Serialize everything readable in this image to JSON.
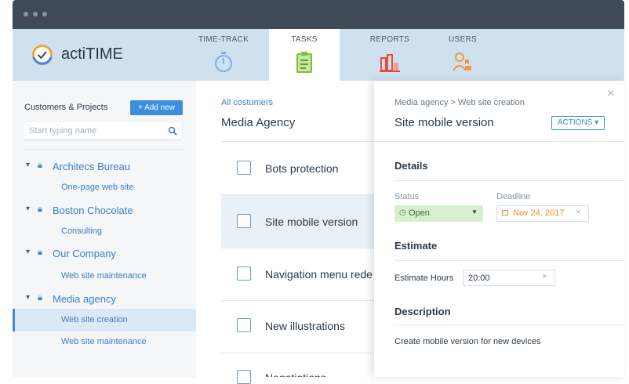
{
  "app": {
    "name": "actiTIME"
  },
  "nav": {
    "time_track": "TIME-TRACK",
    "tasks": "TASKS",
    "reports": "REPORTS",
    "users": "USERS"
  },
  "sidebar": {
    "title": "Customers & Projects",
    "add_button": "+ Add new",
    "search_placeholder": "Start typing name",
    "customers": [
      {
        "name": "Architecs Bureau",
        "projects": [
          "One-page web site"
        ]
      },
      {
        "name": "Boston Chocolate",
        "projects": [
          "Consulting"
        ]
      },
      {
        "name": "Our Company",
        "projects": [
          "Web site maintenance"
        ]
      },
      {
        "name": "Media agency",
        "projects": [
          "Web site creation",
          "Web site maintenance"
        ]
      }
    ]
  },
  "tasks_list": {
    "breadcrumb": "All costumers",
    "title": "Media Agency",
    "items": [
      "Bots protection",
      "Site mobile version",
      "Navigation menu rede",
      "New illustrations",
      "Negotiations"
    ]
  },
  "detail": {
    "breadcrumb": "Media agency  >  Web site creation",
    "title": "Site mobile version",
    "actions_button": "ACTIONS ▾",
    "close": "×",
    "details_heading": "Details",
    "status_label": "Status",
    "status_value": "Open",
    "deadline_label": "Deadline",
    "deadline_value": "Nov 24, 2017",
    "estimate_heading": "Estimate",
    "estimate_label": "Estimate Hours",
    "estimate_value": "20:00",
    "description_heading": "Description",
    "description_text": "Create mobile version for new devices"
  },
  "colors": {
    "accent": "#3c8dde",
    "titlebar": "#3f4a56",
    "header": "#cfe0ef",
    "status_green": "#d6efcf",
    "deadline_orange": "#e8913a"
  }
}
